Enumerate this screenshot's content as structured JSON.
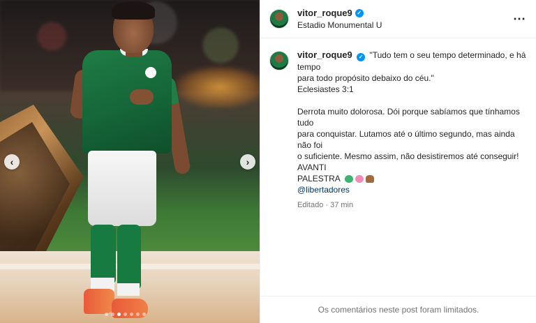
{
  "post": {
    "author": {
      "username": "vitor_roque9",
      "verified": true,
      "location": "Estadio Monumental U"
    },
    "more_icon": "⋯",
    "caption": {
      "username": "vitor_roque9",
      "lines": [
        "\"Tudo tem o seu tempo determinado, e há tempo",
        "para todo propósito debaixo do céu.\"",
        "Eclesiastes 3:1",
        "Derrota muito dolorosa. Dói porque sabíamos que tínhamos tudo",
        "para conquistar. Lutamos até o último segundo, mas ainda não foi",
        "o suficiente. Mesmo assim, não desistiremos até conseguir! AVANTI",
        "PALESTRA"
      ],
      "emoji_icons": [
        "green-heart-icon",
        "pink-heart-icon",
        "praying-hands-icon"
      ],
      "mention": "@libertadores"
    },
    "edited_label": "Editado · 37 min",
    "comments_limited": "Os comentários neste post foram limitados."
  },
  "carousel": {
    "prev_glyph": "‹",
    "next_glyph": "›",
    "slide_count": 7,
    "active_slide": 2
  },
  "colors": {
    "verified": "#0095f6",
    "mention": "#00376b",
    "muted": "#737373",
    "jersey": "#146337"
  }
}
